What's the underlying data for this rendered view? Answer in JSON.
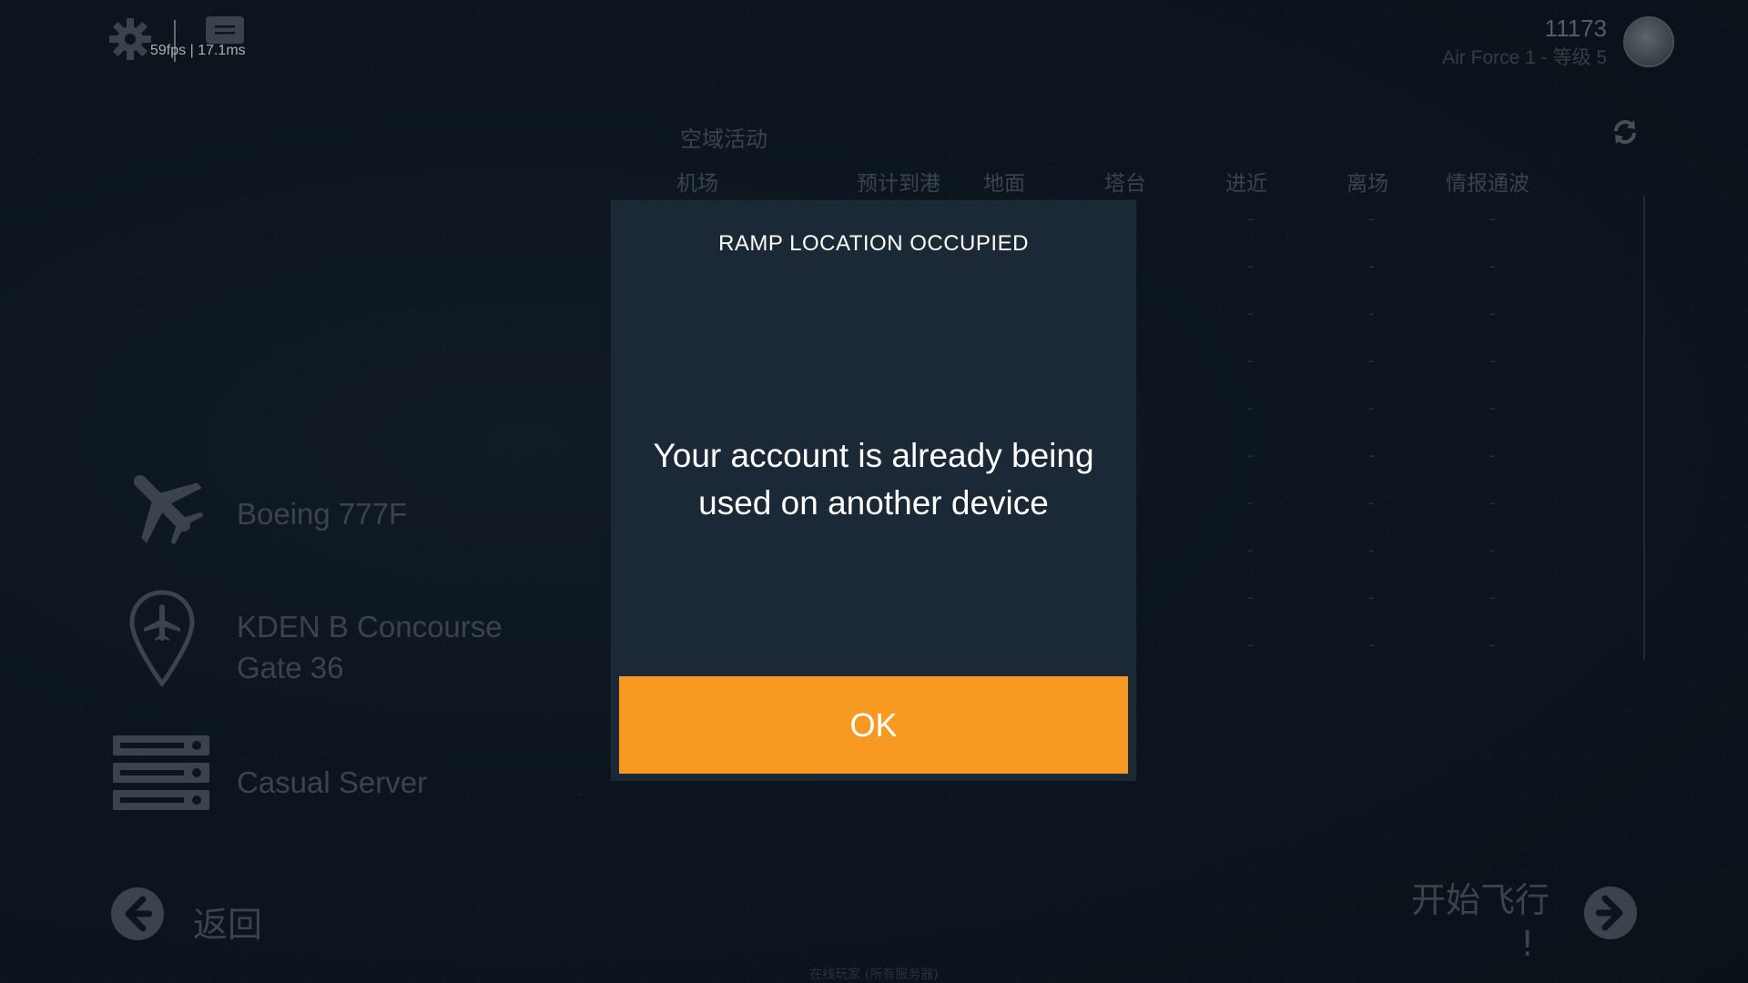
{
  "topbar": {
    "fps_readout": "59fps | 17.1ms",
    "score": "11173",
    "rank_label": "Air Force 1 - 等级 5"
  },
  "activity": {
    "title": "空域活动",
    "columns": [
      "机场",
      "预计到港",
      "地面",
      "塔台",
      "进近",
      "离场",
      "情报通波"
    ]
  },
  "flight_info": {
    "aircraft": "Boeing 777F",
    "location_line1": "KDEN B Concourse",
    "location_line2": "Gate 36",
    "server": "Casual Server"
  },
  "nav": {
    "back_label": "返回",
    "start_label": "开始飞行",
    "start_exclaim": "!",
    "footer_note": "在线玩家 (所有服务器)"
  },
  "dialog": {
    "title": "RAMP LOCATION OCCUPIED",
    "message": "Your account is already being used on another device",
    "ok_label": "OK"
  },
  "colors": {
    "background": "#0d1822",
    "dialog_bg": "#1b2937",
    "accent_orange": "#f89a22",
    "muted_text": "#56616b"
  }
}
